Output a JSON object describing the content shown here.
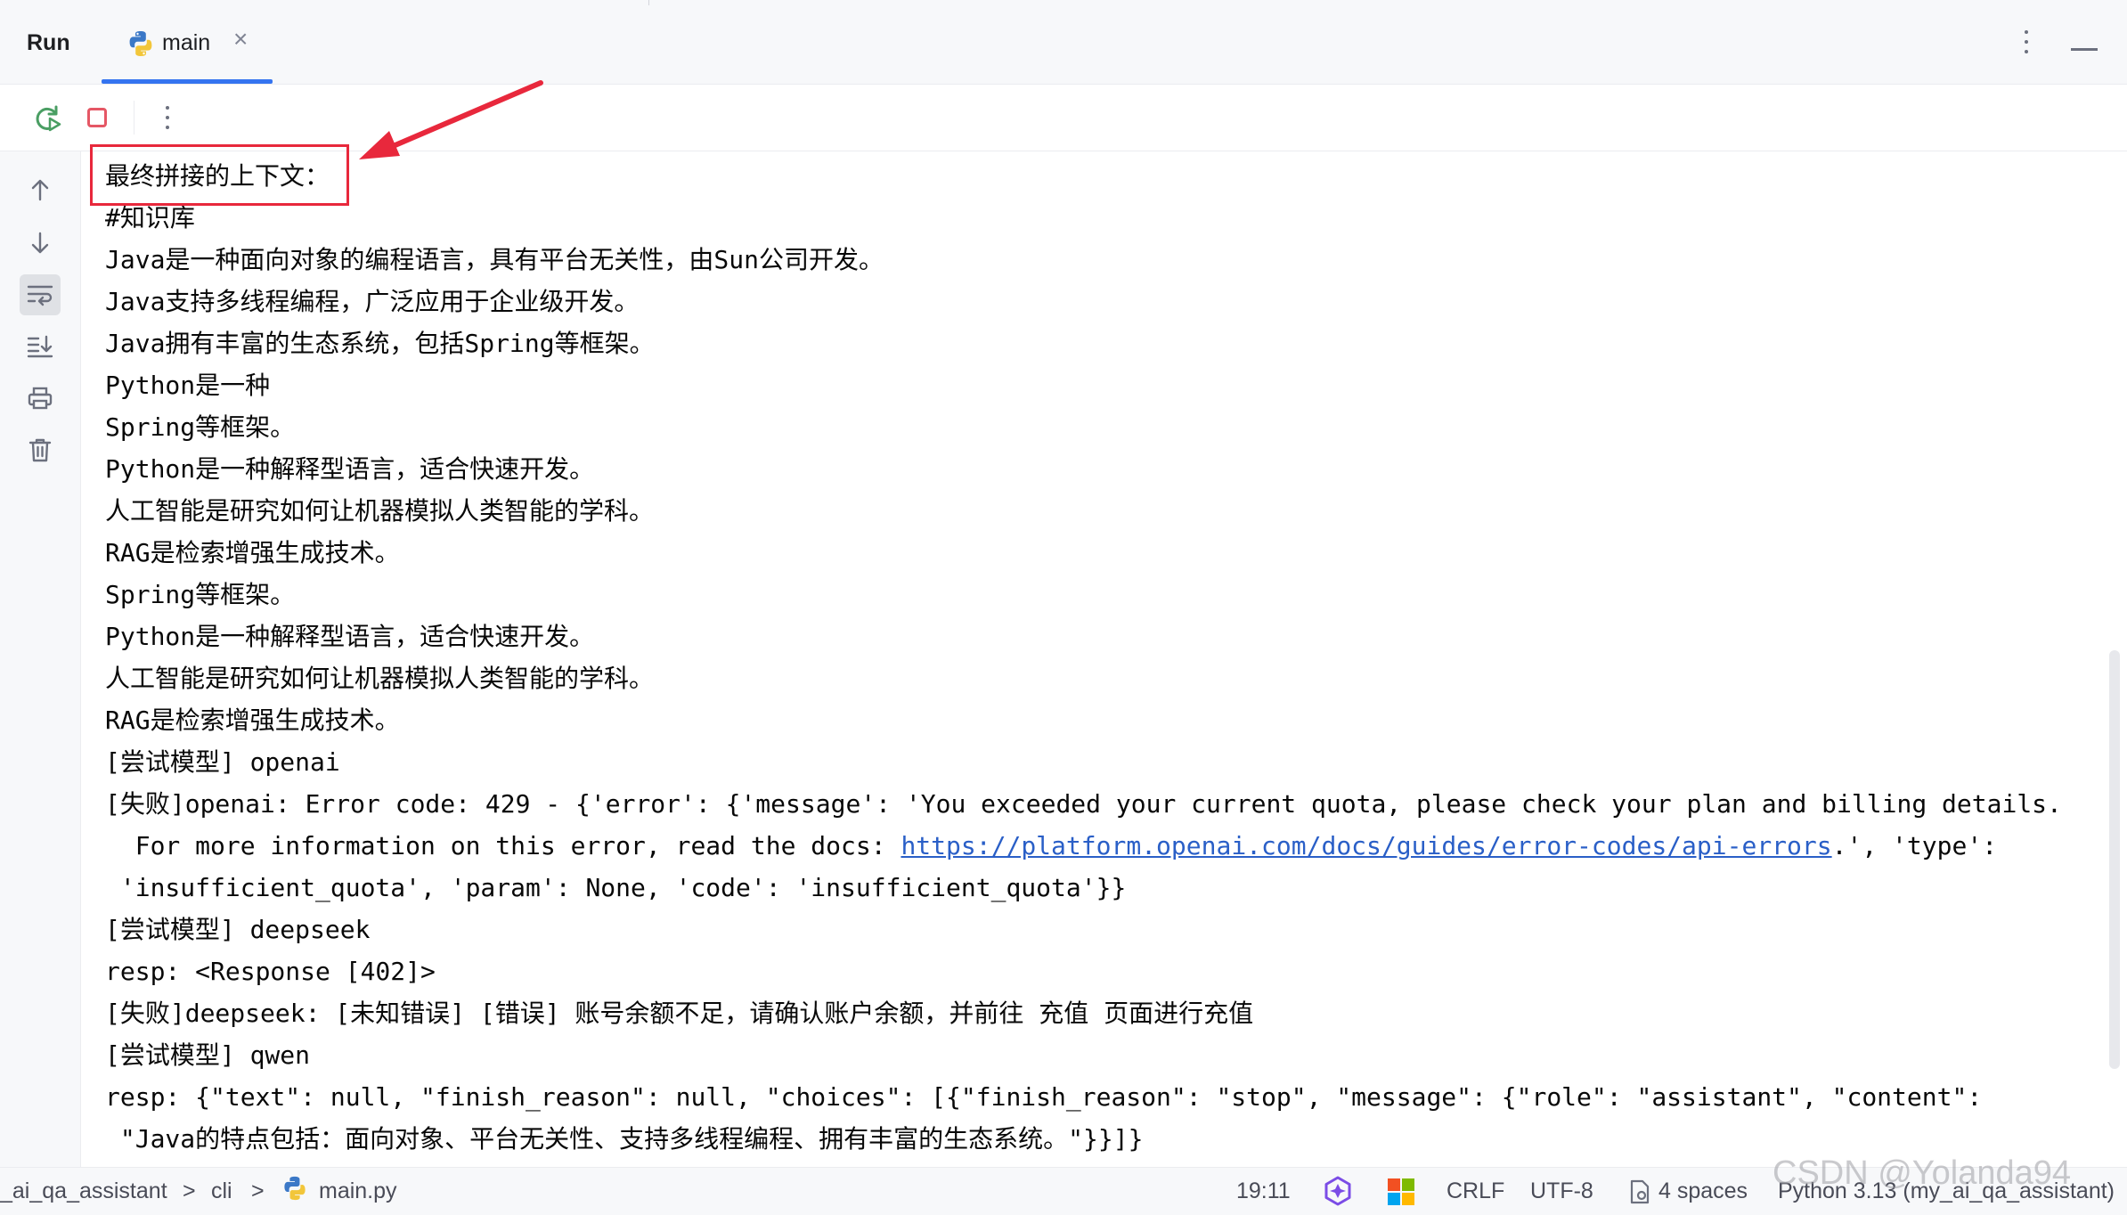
{
  "header": {
    "title": "Run",
    "tab_label": "main",
    "tab_close": "×"
  },
  "colors": {
    "accent": "#3574f0",
    "stop": "#e55765",
    "annotation_red": "#e8283c",
    "link": "#2a5fc7"
  },
  "console": {
    "lines": [
      "最终拼接的上下文：",
      "#知识库",
      "Java是一种面向对象的编程语言，具有平台无关性，由Sun公司开发。",
      "Java支持多线程编程，广泛应用于企业级开发。",
      "Java拥有丰富的生态系统，包括Spring等框架。",
      "Python是一种",
      "Spring等框架。",
      "Python是一种解释型语言，适合快速开发。",
      "人工智能是研究如何让机器模拟人类智能的学科。",
      "RAG是检索增强生成技术。",
      "Spring等框架。",
      "Python是一种解释型语言，适合快速开发。",
      "人工智能是研究如何让机器模拟人类智能的学科。",
      "RAG是检索增强生成技术。",
      "[尝试模型] openai",
      "[失败]openai: Error code: 429 - {'error': {'message': 'You exceeded your current quota, please check your plan and billing details.",
      "",
      " 'insufficient_quota', 'param': None, 'code': 'insufficient_quota'}}",
      "[尝试模型] deepseek",
      "resp: <Response [402]>",
      "[失败]deepseek: [未知错误] [错误] 账号余额不足，请确认账户余额，并前往 充值 页面进行充值",
      "[尝试模型] qwen",
      "resp: {\"text\": null, \"finish_reason\": null, \"choices\": [{\"finish_reason\": \"stop\", \"message\": {\"role\": \"assistant\", \"content\":",
      " \"Java的特点包括：面向对象、平台无关性、支持多线程编程、拥有丰富的生态系统。\"}}]}"
    ],
    "info_prefix": "  For more information on this error, read the docs: ",
    "info_link": "https://platform.openai.com/docs/guides/error-codes/api-errors",
    "info_suffix": ".', 'type':"
  },
  "status": {
    "crumb1": "_ai_qa_assistant",
    "sep1": ">",
    "crumb2": "cli",
    "sep2": ">",
    "file": "main.py",
    "position": "19:11",
    "line_ending": "CRLF",
    "encoding": "UTF-8",
    "indent": "4 spaces",
    "interpreter": "Python 3.13 (my_ai_qa_assistant)"
  },
  "watermark": "CSDN @Yolanda94"
}
